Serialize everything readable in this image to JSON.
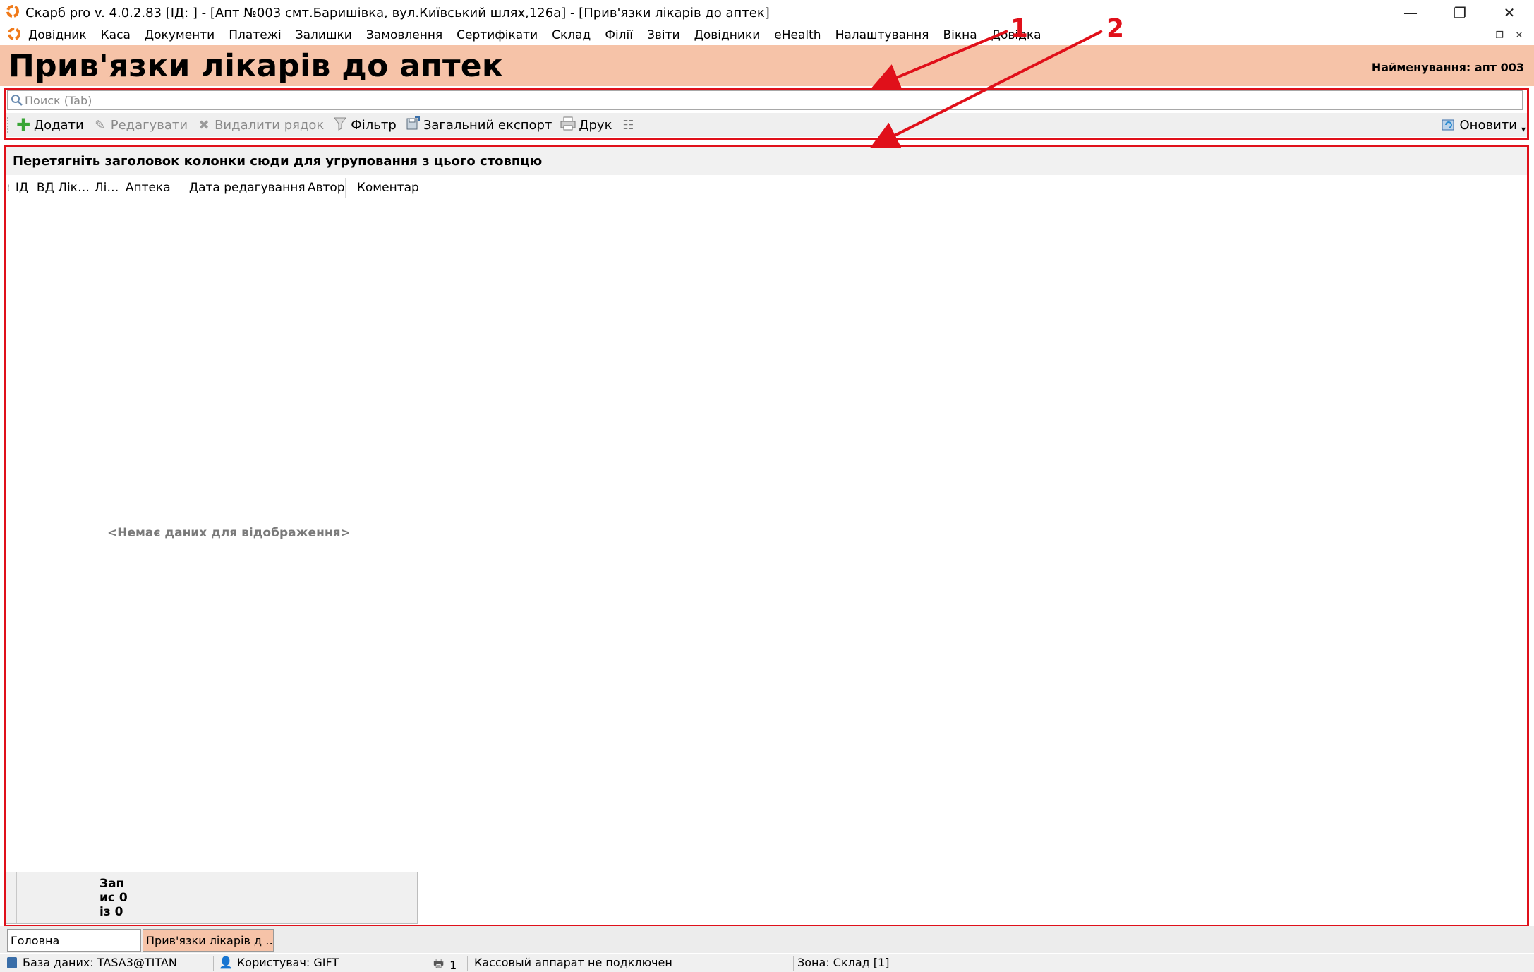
{
  "window": {
    "title": "Скарб pro v. 4.0.2.83 [ІД:       ] - [Апт №003 смт.Баришівка, вул.Київський шлях,126а] - [Прив'язки лікарів до аптек]",
    "logo_icon": "skarb-logo-icon",
    "minimize": "—",
    "restore": "❐",
    "close": "✕"
  },
  "menu": {
    "items": [
      "Довідник",
      "Каса",
      "Документи",
      "Платежі",
      "Залишки",
      "Замовлення",
      "Сертифікати",
      "Склад",
      "Філії",
      "Звіти",
      "Довідники",
      "eHealth",
      "Налаштування",
      "Вікна",
      "Довідка"
    ],
    "mdi_min": "_",
    "mdi_restore": "❐",
    "mdi_close": "✕"
  },
  "header": {
    "title": "Прив'язки лікарів до аптек",
    "name": "Найменування: апт 003",
    "bg": "#f6c3a8"
  },
  "search": {
    "placeholder": "Поиск (Tab)"
  },
  "toolbar": {
    "add": "Додати",
    "edit": "Редагувати",
    "delete": "Видалити рядок",
    "filter": "Фільтр",
    "export": "Загальний експорт",
    "print": "Друк",
    "refresh": "Оновити"
  },
  "grid": {
    "group_hint": "Перетягніть заголовок колонки сюди для угруповання з цього стовпцю",
    "columns": [
      "ІД",
      "ВД Лік…",
      "Лі…",
      "Аптека",
      "Дата редагування",
      "Автор",
      "Коментар"
    ],
    "empty": "<Немає даних для відображення>",
    "records": [
      "Зап",
      "ис 0",
      "із 0"
    ]
  },
  "tabs": [
    "Головна",
    "Прив'язки лікарів д …"
  ],
  "status": {
    "db": "База даних: TASA3@TITAN",
    "user": "Користувач: GIFT",
    "count": "1",
    "cash": "Кассовый аппарат не подключен",
    "zone": "Зона: Склад [1]"
  },
  "annotations": {
    "a1": "1",
    "a2": "2",
    "color": "#e0101a"
  }
}
